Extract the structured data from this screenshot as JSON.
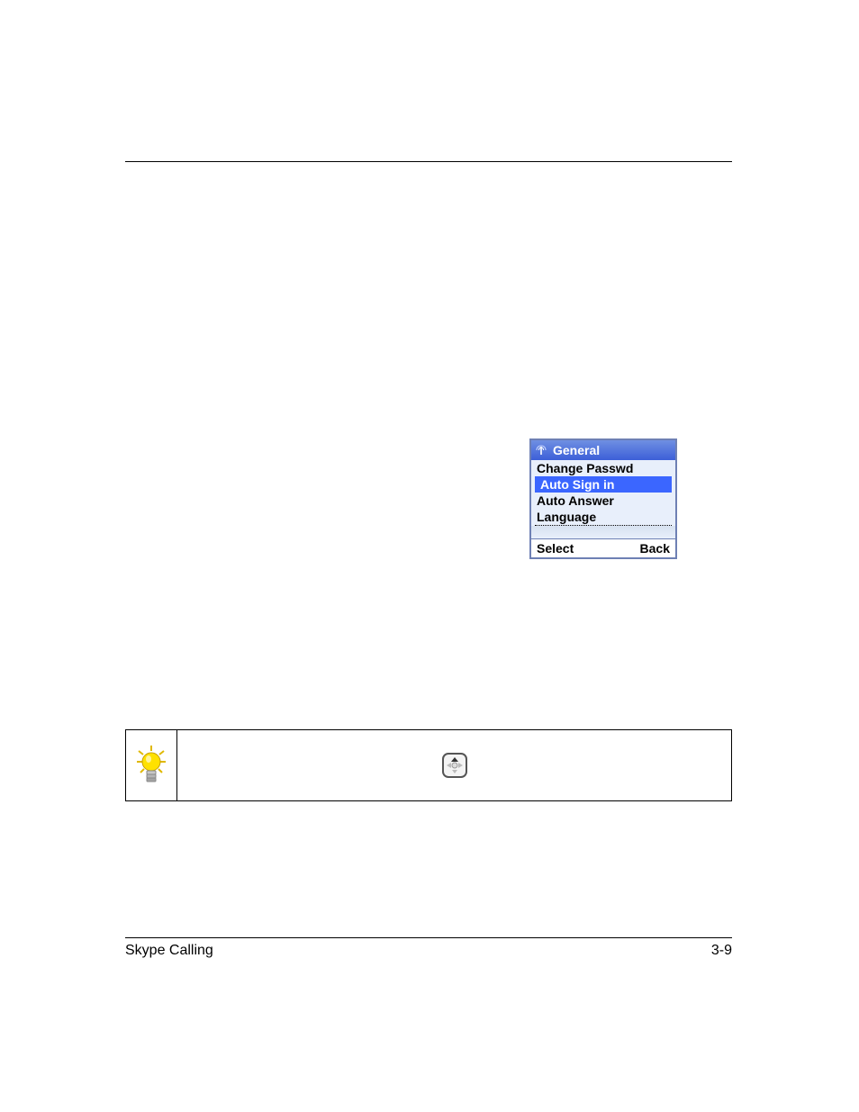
{
  "menu": {
    "title": "General",
    "items": [
      {
        "label": "Change Passwd",
        "selected": false
      },
      {
        "label": "Auto Sign in",
        "selected": true
      },
      {
        "label": "Auto Answer",
        "selected": false
      },
      {
        "label": "Language",
        "selected": false
      }
    ],
    "softkeys": {
      "left": "Select",
      "right": "Back"
    }
  },
  "footer": {
    "left": "Skype Calling",
    "right": "3-9"
  }
}
